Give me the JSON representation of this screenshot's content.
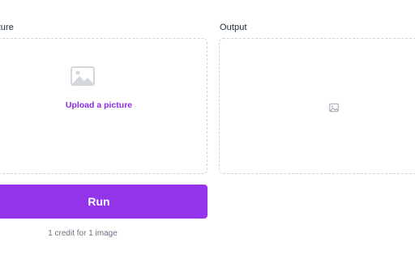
{
  "input": {
    "label": "Picture",
    "dropzone_icon": "image-placeholder-icon",
    "upload_text": "Upload a picture"
  },
  "output": {
    "label": "Output",
    "placeholder_icon": "image-icon"
  },
  "actions": {
    "run_label": "Run",
    "credit_note": "1 credit for 1 image"
  },
  "colors": {
    "accent": "#9333ea",
    "upload_text": "#8b2ee6",
    "border": "#d1d5db",
    "icon": "#c9ced6"
  }
}
